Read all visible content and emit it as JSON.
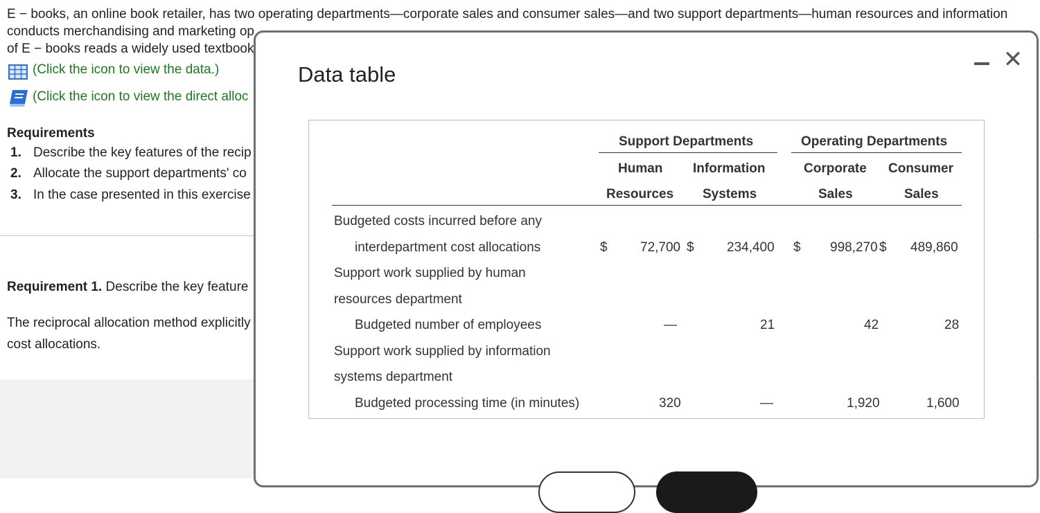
{
  "background": {
    "para_line1": "E − books, an online book retailer, has two operating departments—corporate sales and consumer sales—and two support departments—human resources and information",
    "para_line2": "conducts merchandising and marketing op",
    "para_line3": "of E − books reads a widely used textbook",
    "data_link": "(Click the icon to view the data.)",
    "direct_link": "(Click the icon to view the direct alloc",
    "requirements_title": "Requirements",
    "req1_num": "1.",
    "req1": "Describe the key features of the recip",
    "req2_num": "2.",
    "req2": "Allocate the support departments' co",
    "req3_num": "3.",
    "req3": "In the case presented in this exercise",
    "requirement1_bold": "Requirement 1.",
    "requirement1_text": " Describe the key feature",
    "answer_line1": "The reciprocal allocation method explicitly",
    "answer_line2": "cost allocations."
  },
  "modal": {
    "title": "Data table",
    "minimize_symbol": "",
    "close_symbol": "✕"
  },
  "table": {
    "group1": "Support Departments",
    "group2": "Operating Departments",
    "col1_l1": "Human",
    "col1_l2": "Resources",
    "col2_l1": "Information",
    "col2_l2": "Systems",
    "col3_l1": "Corporate",
    "col3_l2": "Sales",
    "col4_l1": "Consumer",
    "col4_l2": "Sales",
    "row1_l1": "Budgeted costs incurred before any",
    "row1_l2": "interdepartment cost allocations",
    "row1_cur1": "$",
    "row1_v1": "72,700",
    "row1_cur2": "$",
    "row1_v2": "234,400",
    "row1_cur3": "$",
    "row1_v3": "998,270",
    "row1_cur4": "$",
    "row1_v4": "489,860",
    "row2_l1": "Support work supplied by human",
    "row2_l2": "resources department",
    "row2_l3": "Budgeted number of employees",
    "row2_v1": "—",
    "row2_v2": "21",
    "row2_v3": "42",
    "row2_v4": "28",
    "row3_l1": "Support work supplied by information",
    "row3_l2": "systems department",
    "row3_l3": "Budgeted processing time (in minutes)",
    "row3_v1": "320",
    "row3_v2": "—",
    "row3_v3": "1,920",
    "row3_v4": "1,600"
  },
  "colors": {
    "link_green": "#1c7a1c",
    "icon_blue": "#2a6fd6"
  }
}
